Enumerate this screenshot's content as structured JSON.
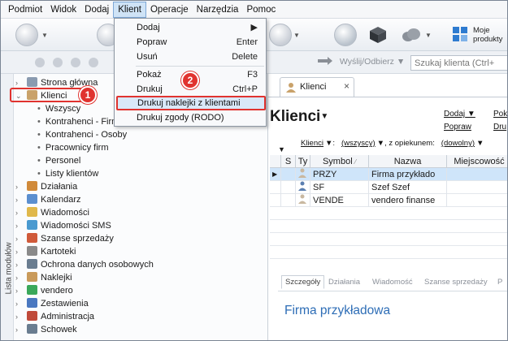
{
  "menubar": [
    "Podmiot",
    "Widok",
    "Dodaj",
    "Klient",
    "Operacje",
    "Narzędzia",
    "Pomoc"
  ],
  "menubar_active": "Klient",
  "toolbar": {
    "moje_produkty": "Moje produkty",
    "wyslij_odbierz": "Wyślij/Odbierz",
    "search_placeholder": "Szukaj klienta (Ctrl+"
  },
  "dropdown": [
    {
      "label": "Dodaj",
      "shortcut": "",
      "submenu": true
    },
    {
      "label": "Popraw",
      "shortcut": "Enter"
    },
    {
      "label": "Usuń",
      "shortcut": "Delete"
    },
    {
      "label": "Pokaż",
      "shortcut": "F3"
    },
    {
      "label": "Drukuj",
      "shortcut": "Ctrl+P"
    },
    {
      "label": "Drukuj naklejki z klientami",
      "shortcut": "",
      "selected": true
    },
    {
      "label": "Drukuj zgody (RODO)",
      "shortcut": ""
    }
  ],
  "sidebar": {
    "vertical_label": "Lista modułów",
    "top": [
      {
        "label": "Strona główna",
        "icon": "home-icon",
        "color": "#8a9bb0"
      },
      {
        "label": "Klienci",
        "icon": "clients-icon",
        "color": "#c9a26a"
      }
    ],
    "sub": [
      "Wszyscy",
      "Kontrahenci - Firmy",
      "Kontrahenci - Osoby",
      "Pracownicy firm",
      "Personel",
      "Listy klientów"
    ],
    "modules": [
      {
        "label": "Działania",
        "icon": "actions-icon",
        "color": "#d08a3a"
      },
      {
        "label": "Kalendarz",
        "icon": "calendar-icon",
        "color": "#5b8fcf"
      },
      {
        "label": "Wiadomości",
        "icon": "messages-icon",
        "color": "#e0b84a"
      },
      {
        "label": "Wiadomości SMS",
        "icon": "sms-icon",
        "color": "#4a9ad0"
      },
      {
        "label": "Szanse sprzedaży",
        "icon": "sales-icon",
        "color": "#d05a3a"
      },
      {
        "label": "Kartoteki",
        "icon": "files-icon",
        "color": "#8a8a8a"
      },
      {
        "label": "Ochrona danych osobowych",
        "icon": "shield-icon",
        "color": "#6a7d90"
      },
      {
        "label": "Naklejki",
        "icon": "labels-icon",
        "color": "#c99a5a"
      },
      {
        "label": "vendero",
        "icon": "vendero-icon",
        "color": "#3aa85a"
      },
      {
        "label": "Zestawienia",
        "icon": "reports-icon",
        "color": "#4a78c0"
      },
      {
        "label": "Administracja",
        "icon": "admin-icon",
        "color": "#c04a3a"
      },
      {
        "label": "Schowek",
        "icon": "clipboard-icon",
        "color": "#6a7d90"
      }
    ]
  },
  "annotations": {
    "badge_1": "1",
    "badge_2": "2"
  },
  "main": {
    "tab_label": "Klienci",
    "title": "Klienci",
    "actions": {
      "dodaj": "Dodaj",
      "popraw": "Popraw",
      "pok": "Pok",
      "dru": "Dru"
    },
    "filter": {
      "klienci": "Klienci",
      "colon": ":",
      "wszyscy": "(wszyscy)",
      "z_opiekunem": ", z opiekunem:",
      "dowolny": "(dowolny)"
    },
    "columns": [
      "S",
      "Ty",
      "Symbol",
      "Nazwa",
      "Miejscowość"
    ],
    "rows": [
      {
        "symbol": "PRZY",
        "nazwa": "Firma przykłado",
        "selected": true
      },
      {
        "symbol": "SF",
        "nazwa": "Szef Szef",
        "selected": false
      },
      {
        "symbol": "VENDE",
        "nazwa": "vendero finanse",
        "selected": false
      }
    ],
    "bottom_tabs": [
      "Szczegóły",
      "Działania",
      "Wiadomość",
      "Szanse sprzedaży",
      "P"
    ],
    "company": "Firma przykładowa"
  },
  "colors": {
    "accent": "#2d6db6",
    "highlight": "#e0332f",
    "selection": "#cfe5fa"
  }
}
